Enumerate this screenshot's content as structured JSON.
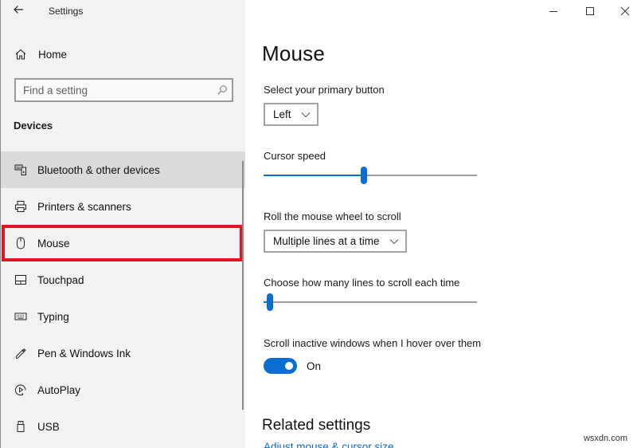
{
  "window": {
    "title": "Settings",
    "controls": {
      "minimize": "minimize-icon",
      "maximize": "maximize-icon",
      "close": "close-icon"
    }
  },
  "sidebar": {
    "back_icon": "back-arrow-icon",
    "home": {
      "label": "Home",
      "icon": "home-icon"
    },
    "search": {
      "placeholder": "Find a setting",
      "value": "",
      "icon": "search-icon"
    },
    "section_title": "Devices",
    "items": [
      {
        "label": "Bluetooth & other devices",
        "icon": "bluetooth-devices-icon",
        "state": "hover"
      },
      {
        "label": "Printers & scanners",
        "icon": "printer-icon",
        "state": ""
      },
      {
        "label": "Mouse",
        "icon": "mouse-icon",
        "state": "selected-highlighted"
      },
      {
        "label": "Touchpad",
        "icon": "touchpad-icon",
        "state": ""
      },
      {
        "label": "Typing",
        "icon": "keyboard-icon",
        "state": ""
      },
      {
        "label": "Pen & Windows Ink",
        "icon": "pen-icon",
        "state": ""
      },
      {
        "label": "AutoPlay",
        "icon": "autoplay-icon",
        "state": ""
      },
      {
        "label": "USB",
        "icon": "usb-icon",
        "state": ""
      }
    ],
    "highlight_color": "#e2141f"
  },
  "main": {
    "title": "Mouse",
    "primary_button": {
      "label": "Select your primary button",
      "value": "Left"
    },
    "cursor_speed": {
      "label": "Cursor speed",
      "value_fraction": 0.47
    },
    "wheel_scroll": {
      "label": "Roll the mouse wheel to scroll",
      "value": "Multiple lines at a time"
    },
    "lines_to_scroll": {
      "label": "Choose how many lines to scroll each time",
      "value_fraction": 0.03
    },
    "scroll_inactive": {
      "label": "Scroll inactive windows when I hover over them",
      "state": "On",
      "enabled": true
    },
    "related_settings": {
      "title": "Related settings",
      "links": [
        "Adjust mouse & cursor size"
      ]
    },
    "accent_color": "#0a6ed1"
  },
  "watermark": "wsxdn.com"
}
